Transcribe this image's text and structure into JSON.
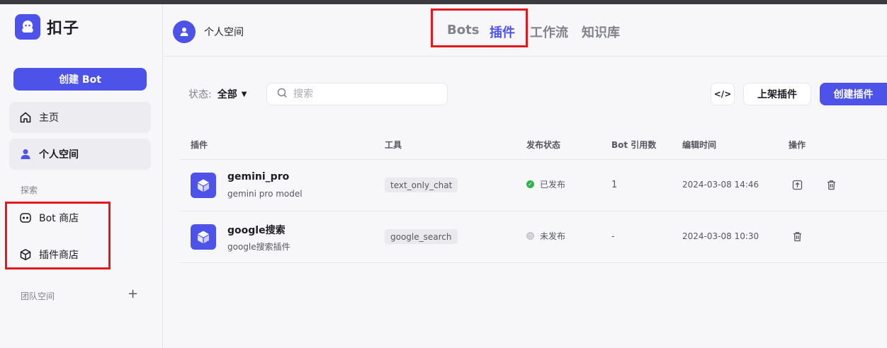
{
  "app": {
    "logo_text": "扣子"
  },
  "sidebar": {
    "create_bot": "创建 Bot",
    "home": "主页",
    "personal_space": "个人空间",
    "explore_label": "探索",
    "bot_store": "Bot 商店",
    "plugin_store": "插件商店",
    "team_space": "团队空间"
  },
  "header": {
    "user_name": "个人空间",
    "tabs": [
      {
        "label": "Bots",
        "active": false
      },
      {
        "label": "插件",
        "active": true
      },
      {
        "label": "工作流",
        "active": false
      },
      {
        "label": "知识库",
        "active": false
      }
    ]
  },
  "toolbar": {
    "status_label": "状态:",
    "status_value": "全部",
    "search_placeholder": "搜索",
    "code_icon": "</>",
    "list_plugin": "上架插件",
    "create_plugin": "创建插件"
  },
  "table": {
    "headers": [
      "插件",
      "工具",
      "发布状态",
      "Bot 引用数",
      "编辑时间",
      "操作"
    ],
    "rows": [
      {
        "name": "gemini_pro",
        "desc": "gemini pro model",
        "tool": "text_only_chat",
        "status": "已发布",
        "published": true,
        "refs": "1",
        "time": "2024-03-08 14:46"
      },
      {
        "name": "google搜索",
        "desc": "google搜索插件",
        "tool": "google_search",
        "status": "未发布",
        "published": false,
        "refs": "-",
        "time": "2024-03-08 10:30"
      }
    ]
  },
  "colors": {
    "accent": "#4d53e8",
    "highlight": "#e5161c",
    "published": "#30b24b",
    "unpublished": "#c5c6cc"
  }
}
